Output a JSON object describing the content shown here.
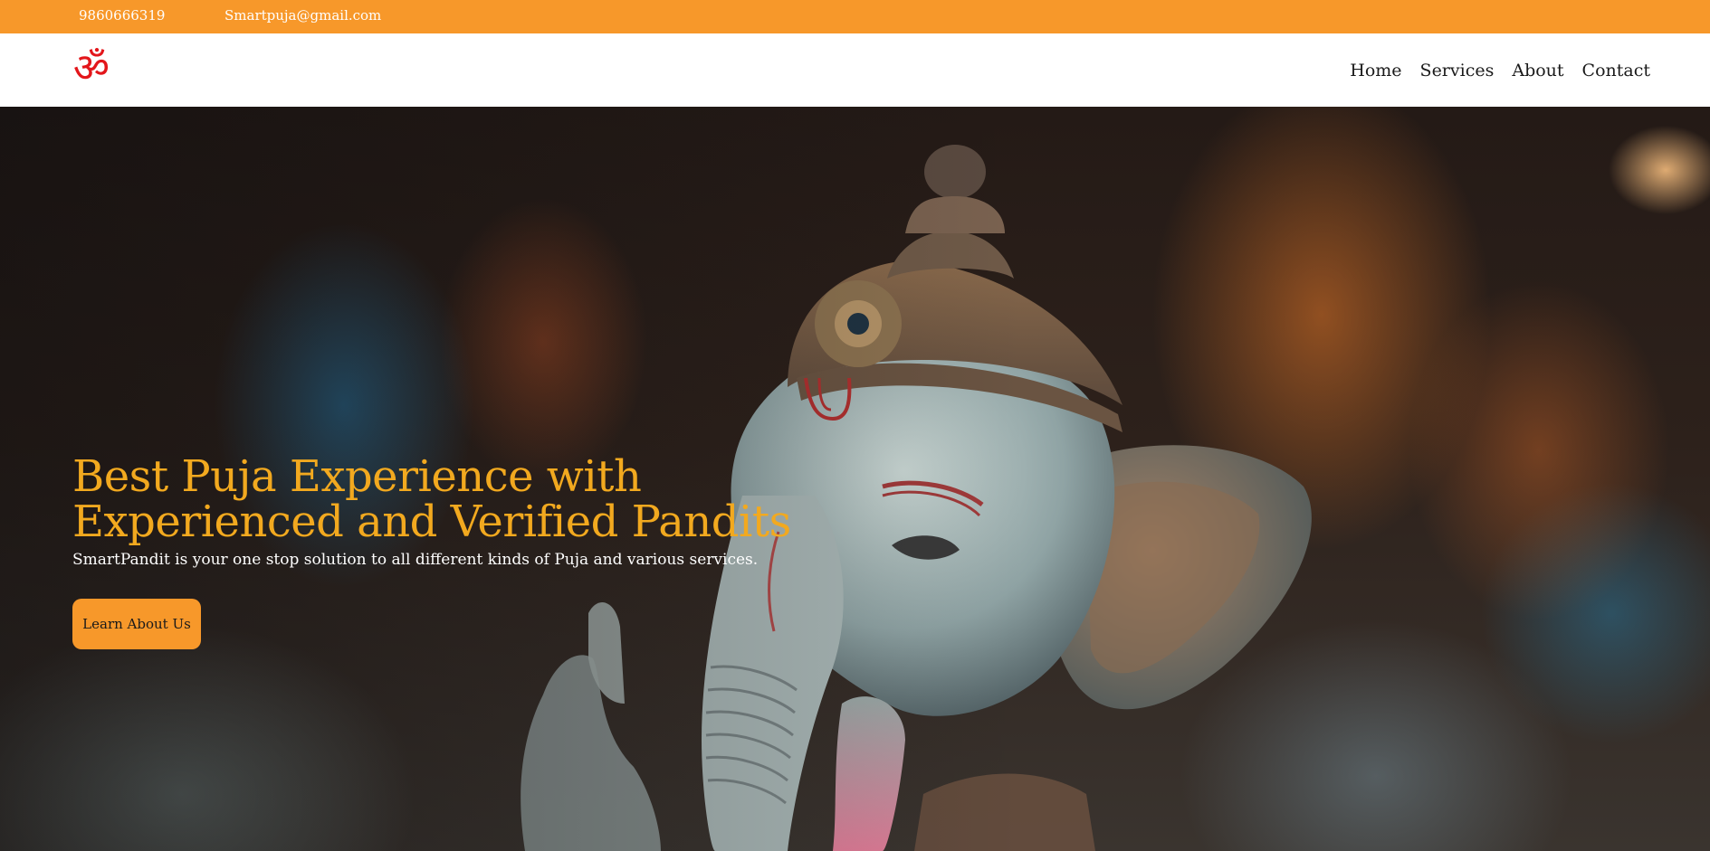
{
  "topbar": {
    "phone": "9860666319",
    "email": "Smartpuja@gmail.com",
    "background": "#f7982a"
  },
  "nav": {
    "logo_icon": "om-symbol-icon",
    "logo_glyph": "ॐ",
    "logo_color": "#e3161b",
    "items": [
      {
        "label": "Home"
      },
      {
        "label": "Services"
      },
      {
        "label": "About"
      },
      {
        "label": "Contact"
      }
    ]
  },
  "hero": {
    "image": "ganesha-idol-photo",
    "title_line1": "Best Puja Experience with",
    "title_line2": "Experienced and Verified Pandits",
    "title_color": "#f2a91f",
    "subtitle": "SmartPandit is your one stop solution to all different kinds of Puja and various services.",
    "cta_label": "Learn About Us",
    "cta_color": "#f7982a"
  }
}
